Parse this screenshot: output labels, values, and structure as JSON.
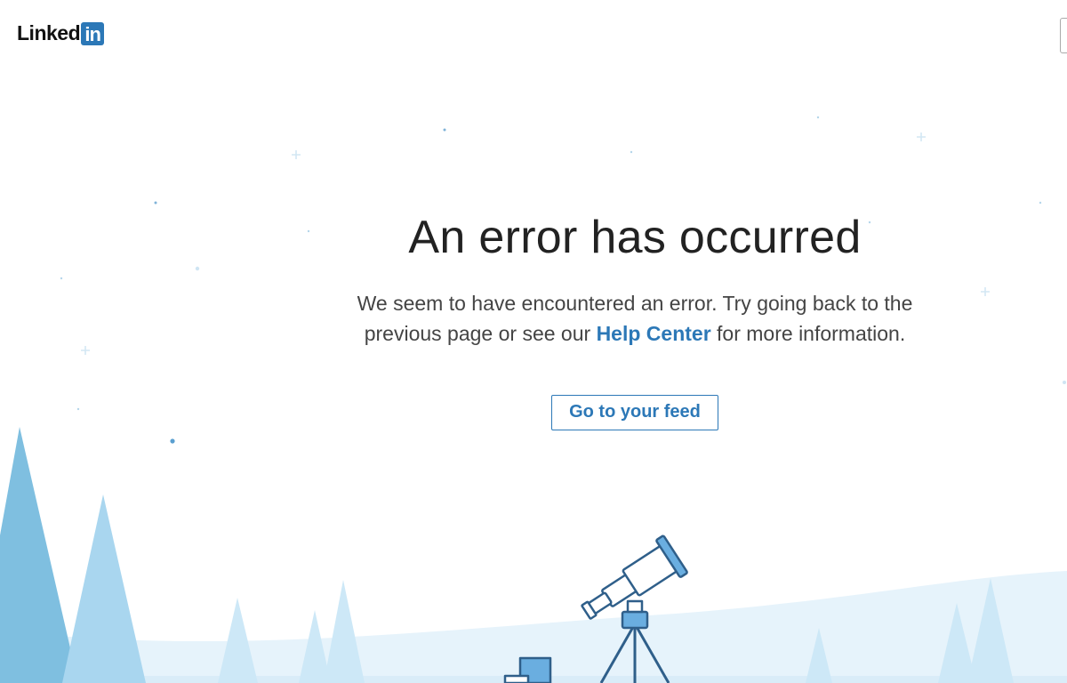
{
  "brand": {
    "logo_word": "Linked",
    "logo_in": "in"
  },
  "error": {
    "title": "An error has occurred",
    "message_before": "We seem to have encountered an error. Try going back to the previous page or see our",
    "help_link_label": "Help Center",
    "message_after": "for more information.",
    "cta_label": "Go to your feed"
  },
  "colors": {
    "accent": "#2c78b7",
    "tree_dark": "#7fbfe0",
    "tree_light": "#b6dcf0",
    "snow_hill": "#e6f3fb"
  },
  "icons": [
    "telescope-icon",
    "tree-icon",
    "star-icon"
  ]
}
